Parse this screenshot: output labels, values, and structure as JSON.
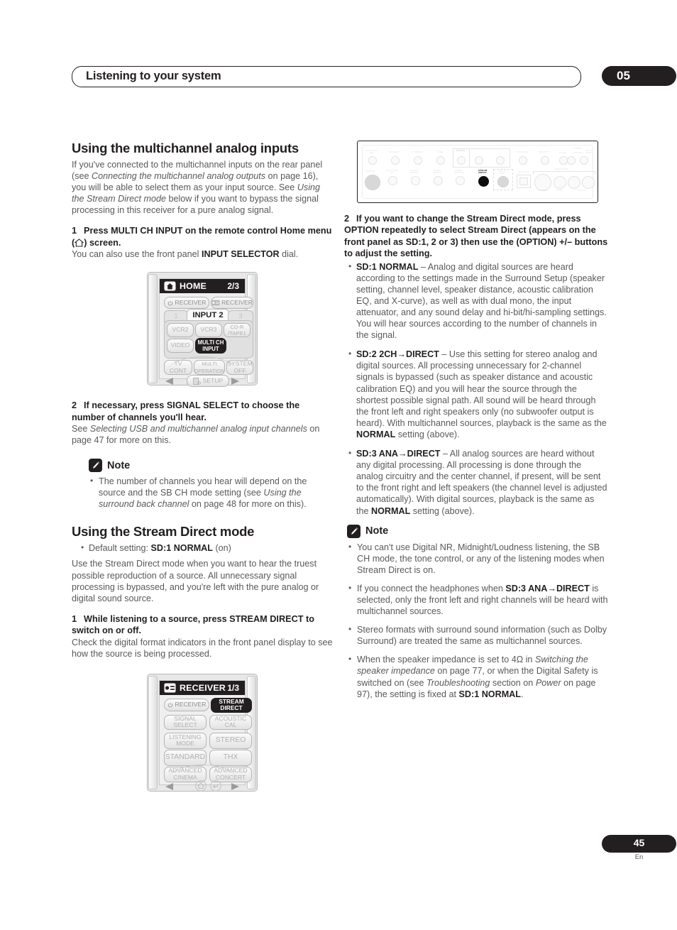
{
  "header": {
    "title": "Listening to your system",
    "chapter": "05"
  },
  "footer": {
    "page": "45",
    "lang": "En"
  },
  "left": {
    "heading": "Using the multichannel analog inputs",
    "intro_1": "If you've connected to the multichannel inputs on the rear panel (see ",
    "intro_i1": "Connecting the multichannel analog outputs",
    "intro_2": " on page 16), you will be able to select them as your input source. See ",
    "intro_i2": "Using the Stream Direct mode",
    "intro_3": " below if you want to bypass the signal processing in this receiver for a pure analog signal.",
    "step1_num": "1",
    "step1_a": "Press MULTI CH INPUT on the remote control Home menu (",
    "step1_b": ") screen.",
    "step1_sub_a": "You can also use the front panel ",
    "step1_sub_b": "INPUT SELECTOR",
    "step1_sub_c": " dial.",
    "step2_num": "2",
    "step2_text": "If necessary, press SIGNAL SELECT to choose the number of channels you'll hear.",
    "step2_sub_a": "See ",
    "step2_sub_i": "Selecting USB and multichannel analog input channels",
    "step2_sub_b": " on page 47 for more on this.",
    "note_title": "Note",
    "note_items": [
      {
        "a": "The number of channels you hear will depend on the source and the SB CH mode setting (see ",
        "i": "Using the surround back channel",
        "b": " on page 48 for more on this)."
      }
    ],
    "heading2": "Using the Stream Direct mode",
    "default_a": "Default setting: ",
    "default_b": "SD:1 NORMAL",
    "default_c": " (on)",
    "sd_intro": "Use the Stream Direct mode when you want to hear the truest possible reproduction of a source. All unnecessary signal processing is bypassed, and you're left with the pure analog or digital sound source.",
    "sd_step1_num": "1",
    "sd_step1_text": "While listening to a source, press STREAM DIRECT to switch on or off.",
    "sd_step1_sub": "Check the digital format indicators in the front panel display to see how the source is being processed."
  },
  "remote_home": {
    "icon": "home-icon",
    "title": "HOME",
    "page": "2/3",
    "row_power": "RECEIVER",
    "row_receiver": "RECEIVER",
    "tabs": [
      "1",
      "INPUT 2",
      "3"
    ],
    "selected_tab": "INPUT 2",
    "buttons": [
      "VCR2",
      "VCR3",
      "CD-R\n/TAPE1",
      "VIDEO",
      "MULTI CH\nINPUT"
    ],
    "highlighted": "MULTI CH INPUT",
    "bottom_buttons": [
      "TV\nCONT",
      "MULTI\nOPERATION",
      "SYSTEM\nOFF"
    ],
    "setup": "SETUP"
  },
  "remote_receiver": {
    "icon": "receiver-icon",
    "title": "RECEIVER",
    "page": "1/3",
    "row_power": "RECEIVER",
    "highlighted": "STREAM DIRECT",
    "buttons": [
      "STREAM\nDIRECT",
      "SIGNAL\nSELECT",
      "ACOUSTIC\nCAL",
      "LISTENING\nMODE",
      "STEREO",
      "STANDARD",
      "THX",
      "ADVANCED\nCINEMA",
      "ADVANCED\nCONCERT"
    ]
  },
  "front_panel": {
    "top_labels": [
      "ACOUSTIC\nCAL",
      "MIDNIGHT",
      "LOUDNESS",
      "TONE",
      "OPTION",
      "–",
      "+",
      "DIGITAL NR",
      "INPUT ATT",
      "CLASS",
      "TUNER",
      "–  STATION  +",
      "SB CH\nMODE"
    ],
    "bottom_labels": [
      "PHONES",
      "SP SYSTEM\nA/B",
      "SIGNAL\nSELECT",
      "VIDEO\nSELECT",
      "TAPE/2\nMONITOR",
      "STREAM\nDIRECT",
      "SET UP\nMIC",
      "DIGITAL IN",
      "VIDEO INPUT",
      "S VIDEO",
      "VIDEO",
      "L   AUDIO   R"
    ],
    "highlighted": "STREAM DIRECT"
  },
  "right": {
    "step2_num": "2",
    "step2_text": "If you want to change the Stream Direct mode, press OPTION repeatedly to select Stream Direct (appears on the front panel as SD:1, 2 or 3) then use the (OPTION) +/– buttons to adjust the setting.",
    "modes": [
      {
        "name": "SD:1 NORMAL",
        "dash": " – ",
        "text_a": "Analog and digital sources are heard according to the settings made in the Surround Setup (speaker setting, channel level, speaker distance, acoustic calibration EQ, and X-curve), as well as with dual mono, the input attenuator, and any sound delay and hi-bit/hi-sampling settings. You will hear sources according to the number of channels in the signal."
      },
      {
        "name": "SD:2 2CH→DIRECT",
        "dash": " – ",
        "text_a": "Use this setting for stereo analog and digital sources. All processing unnecessary for 2-channel signals is bypassed (such as speaker distance and acoustic calibration EQ) and you will hear the source through the shortest possible signal path. All sound will be heard through the front left and right speakers only (no subwoofer output is heard). With multichannel sources, playback is the same as the ",
        "bold_mid": "NORMAL",
        "text_b": " setting (above)."
      },
      {
        "name": "SD:3 ANA→DIRECT",
        "dash": " – ",
        "text_a": "All analog sources are heard without any digital processing. All processing is done through the analog circuitry and the center channel, if present, will be sent to the front right and left speakers (the channel level is adjusted automatically). With digital sources, playback is the same as the ",
        "bold_mid": "NORMAL",
        "text_b": " setting (above)."
      }
    ],
    "note_title": "Note",
    "note_items": [
      {
        "a": "You can't use Digital NR, Midnight/Loudness listening, the SB CH mode, the tone control, or any of the listening modes when Stream Direct is on."
      },
      {
        "a": "If you connect the headphones when ",
        "b1": "SD:3 ANA→DIRECT",
        "c": " is selected, only the front left and right channels will be heard with multichannel sources."
      },
      {
        "a": "Stereo formats with surround sound information (such as Dolby Surround) are treated the same as multichannel sources."
      },
      {
        "a": "When the speaker impedance is set to 4Ω in ",
        "i1": "Switching the speaker impedance",
        "b": " on page 77, or when the Digital Safety is switched on (see ",
        "i2": "Troubleshooting",
        "c": " section on ",
        "i3": "Power",
        "d": " on page 97), the setting is fixed at ",
        "bold_end": "SD:1 NORMAL",
        "e": "."
      }
    ]
  }
}
